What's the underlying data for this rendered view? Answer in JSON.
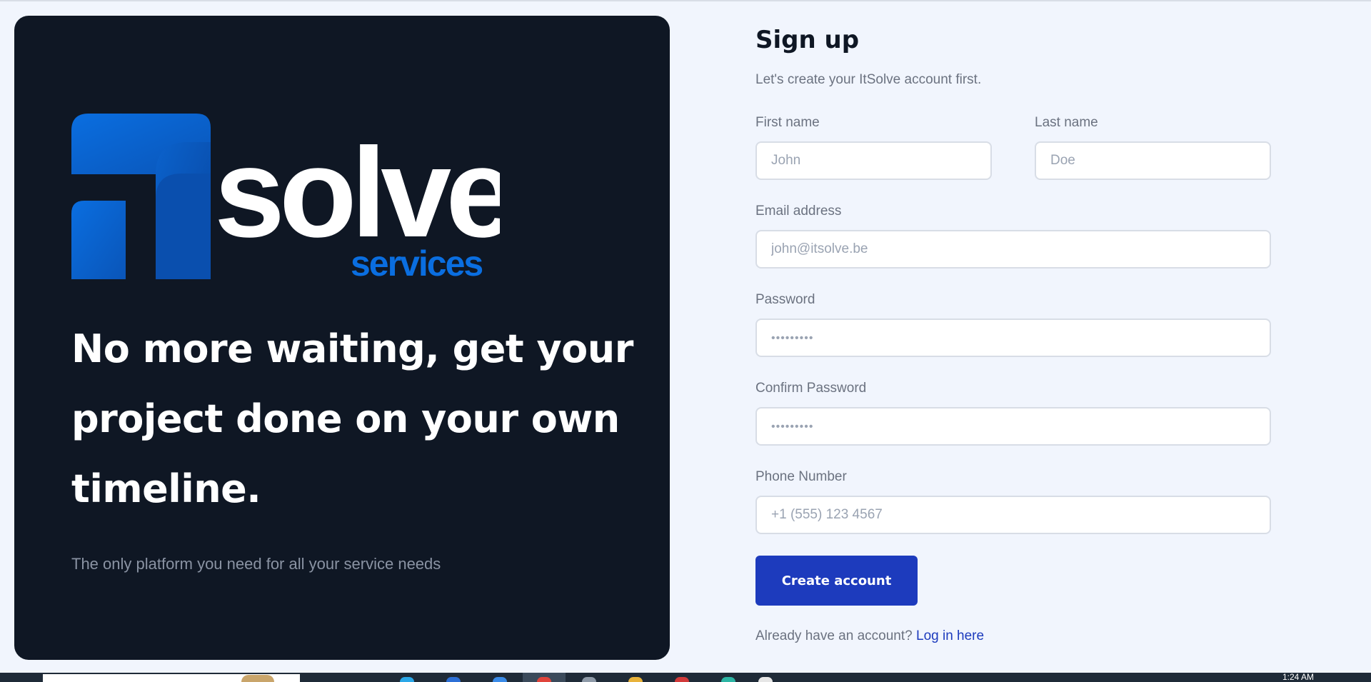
{
  "brand": {
    "logo_word": "solve",
    "logo_sub": "services",
    "colors": {
      "panel_bg": "#0f1724",
      "logo_blue": "#0a6ee0",
      "logo_blue_dark": "#0a55b8",
      "accent": "#1d3bbd"
    }
  },
  "hero": {
    "headline_lines": [
      "No more waiting, get your",
      "project done on your own",
      "timeline."
    ],
    "tagline": "The only platform you need for all your service needs"
  },
  "form": {
    "title": "Sign up",
    "subtitle": "Let's create your ItSolve account first.",
    "first_name": {
      "label": "First name",
      "placeholder": "John"
    },
    "last_name": {
      "label": "Last name",
      "placeholder": "Doe"
    },
    "email": {
      "label": "Email address",
      "placeholder": "john@itsolve.be"
    },
    "password": {
      "label": "Password",
      "placeholder": "•••••••••"
    },
    "confirm_password": {
      "label": "Confirm Password",
      "placeholder": "•••••••••"
    },
    "phone": {
      "label": "Phone Number",
      "placeholder": "+1 (555) 123 4567"
    },
    "submit_label": "Create account",
    "login_prompt": "Already have an account?",
    "login_link": "Log in here"
  },
  "taskbar": {
    "clock": "1:24 AM"
  }
}
